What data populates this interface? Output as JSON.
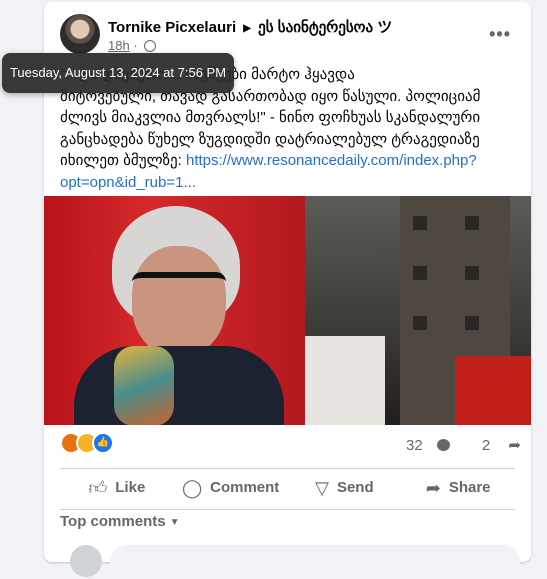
{
  "post": {
    "author": "Tornike Picxelauri",
    "page_arrow": "▶",
    "page": "ეს საინტერესოა ツ",
    "time": "18h",
    "separator": "·",
    "tooltip": "Tuesday, August 13, 2024 at 7:56 PM",
    "more_label": "•••",
    "text_lines": [
      "\"...და დავწერო... ბავშვები მარტო ჰყავდა",
      "მიტოვებული, თავად გასართობად იყო წასული. პოლიციამ",
      "ძლივს მიაკვლია მთვრალს!\" - ნინო ფოჩხუას სკანდალური",
      "განცხადება წუხელ ზუგდიდში დატრიალებულ ტრაგედიაზე",
      "იხილეთ ბმულზე: "
    ],
    "link_line1": "https://www.resonancedaily.com/index.php?",
    "link_line2": "opt=opn&id_rub=1..."
  },
  "reactions": {
    "icons": [
      "angry-reaction",
      "sad-reaction",
      "like-reaction"
    ],
    "comments_count": "32",
    "shares_count": "2"
  },
  "actions": {
    "like": "Like",
    "comment": "Comment",
    "send": "Send",
    "share": "Share"
  },
  "comments": {
    "sort_label": "Top comments"
  },
  "colors": {
    "link": "#216fdb",
    "like_blue": "#1877f2"
  }
}
